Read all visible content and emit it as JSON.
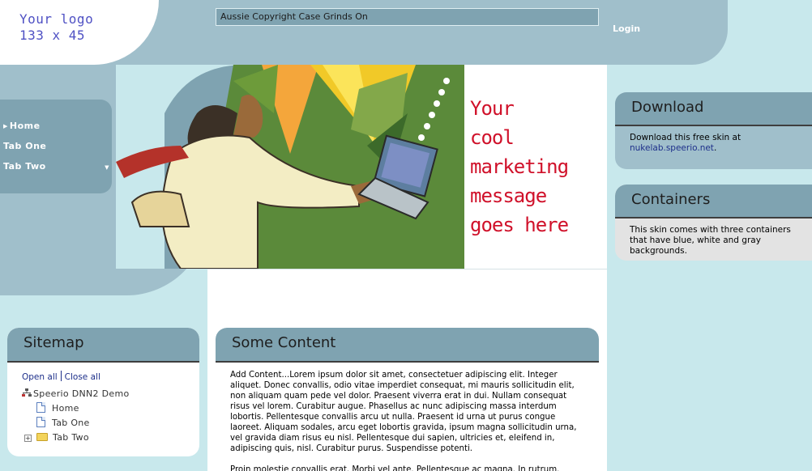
{
  "header": {
    "logo_line1": "Your logo",
    "logo_line2": "133 x 45",
    "ticker_text": "Aussie Copyright Case Grinds On",
    "login_label": "Login"
  },
  "nav": {
    "items": [
      {
        "label": "Home",
        "active": true
      },
      {
        "label": "Tab One"
      },
      {
        "label": "Tab Two",
        "has_submenu": true
      }
    ]
  },
  "banner": {
    "marketing_message": "Your\ncool\nmarketing\nmessage\ngoes here"
  },
  "download_pane": {
    "title": "Download",
    "text": "Download this free skin at",
    "link": "nukelab.speerio.net",
    "trailing": "."
  },
  "containers_pane": {
    "title": "Containers",
    "text": "This skin comes with three containers that have blue, white and gray backgrounds."
  },
  "sitemap_pane": {
    "title": "Sitemap",
    "open_all": "Open all",
    "close_all": "Close all",
    "root": "Speerio DNN2 Demo",
    "children": [
      "Home",
      "Tab One",
      "Tab Two"
    ]
  },
  "content_pane": {
    "title": "Some Content",
    "paragraph1": "Add Content...Lorem ipsum dolor sit amet, consectetuer adipiscing elit. Integer aliquet. Donec convallis, odio vitae imperdiet consequat, mi mauris sollicitudin elit, non aliquam quam pede vel dolor. Praesent viverra erat in dui. Nullam consequat risus vel lorem. Curabitur augue. Phasellus ac nunc adipiscing massa interdum lobortis. Pellentesque convallis arcu ut nulla. Praesent id urna ut purus congue laoreet. Aliquam sodales, arcu eget lobortis gravida, ipsum magna sollicitudin urna, vel gravida diam risus eu nisl. Pellentesque dui sapien, ultricies et, eleifend in, adipiscing quis, nisl. Curabitur purus. Suspendisse potenti.",
    "paragraph2": "Proin molestie convallis erat. Morbi vel ante. Pellentesque ac magna. In rutrum. Quisque"
  },
  "colors": {
    "page_bg": "#c8e8ec",
    "band": "#a0bfcb",
    "header_steel": "#7fa3b1",
    "accent_red": "#d0112a",
    "logo_purple": "#4f51c4",
    "link_blue": "#1d2f8a"
  }
}
